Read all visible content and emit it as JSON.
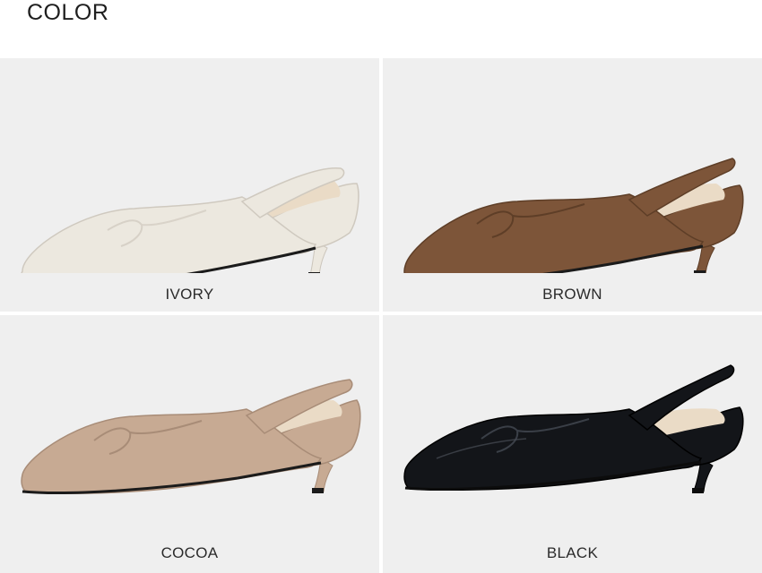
{
  "heading": "COLOR",
  "products": [
    {
      "label": "IVORY",
      "color": "#ece8df"
    },
    {
      "label": "BROWN",
      "color": "#7d5539"
    },
    {
      "label": "COCOA",
      "color": "#c7aa93"
    },
    {
      "label": "BLACK",
      "color": "#131519"
    }
  ],
  "lining_color": "#eadbc6",
  "background_color": "#efefef"
}
